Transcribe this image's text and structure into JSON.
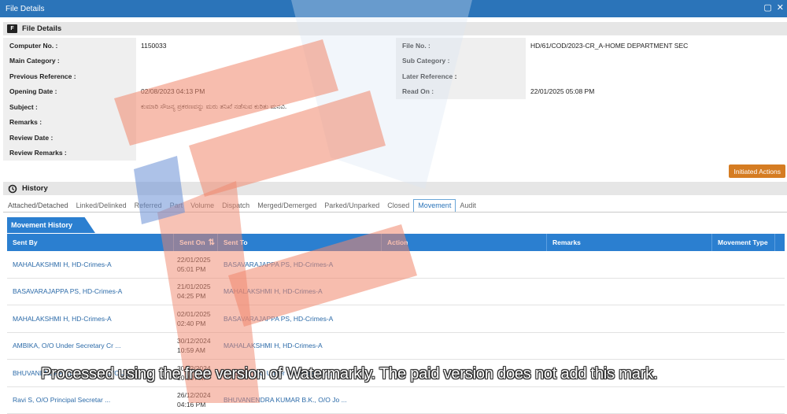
{
  "window": {
    "title": "File Details"
  },
  "file_details": {
    "heading": "File Details",
    "icon_label": "F",
    "left": [
      {
        "label": "Computer No. :",
        "value": "1150033"
      },
      {
        "label": "Main Category :",
        "value": ""
      },
      {
        "label": "Previous Reference :",
        "value": ""
      },
      {
        "label": "Opening Date :",
        "value": "02/08/2023 04:13 PM"
      },
      {
        "label": "Subject :",
        "value": "ಕುಮಾರಿ ಸೌಜನ್ಯ ಪ್ರಕರಣವನ್ನು ಮರು ತನಿಖೆ ನಡೆಸುವ ಕುರಿತು ಮನವಿ."
      },
      {
        "label": "Remarks :",
        "value": ""
      },
      {
        "label": "Review Date :",
        "value": ""
      },
      {
        "label": "Review Remarks :",
        "value": ""
      }
    ],
    "right": [
      {
        "label": "File No. :",
        "value": "HD/61/COD/2023-CR_A-HOME DEPARTMENT SEC"
      },
      {
        "label": "Sub Category :",
        "value": ""
      },
      {
        "label": "Later Reference :",
        "value": ""
      },
      {
        "label": "Read On :",
        "value": "22/01/2025 05:08 PM"
      }
    ]
  },
  "actions_button": "Initiated Actions",
  "history": {
    "heading": "History",
    "tabs": [
      "Attached/Detached",
      "Linked/Delinked",
      "Referred",
      "Part",
      "Volume",
      "Dispatch",
      "Merged/Demerged",
      "Parked/Unparked",
      "Closed",
      "Movement",
      "Audit"
    ],
    "active_tab": "Movement",
    "panel_title": "Movement History",
    "columns": [
      "Sent By",
      "Sent On",
      "Sent To",
      "Action",
      "Remarks",
      "Movement Type"
    ],
    "sort_icon": "sort-icon",
    "rows": [
      {
        "sent_by": "MAHALAKSHMI H, HD-Crimes-A",
        "sent_on_date": "22/01/2025",
        "sent_on_time": "05:01 PM",
        "sent_to": "BASAVARAJAPPA PS, HD-Crimes-A",
        "action": "",
        "remarks": "",
        "movement_type": ""
      },
      {
        "sent_by": "BASAVARAJAPPA PS, HD-Crimes-A",
        "sent_on_date": "21/01/2025",
        "sent_on_time": "04:25 PM",
        "sent_to": "MAHALAKSHMI H, HD-Crimes-A",
        "action": "",
        "remarks": "",
        "movement_type": ""
      },
      {
        "sent_by": "MAHALAKSHMI H, HD-Crimes-A",
        "sent_on_date": "02/01/2025",
        "sent_on_time": "02:40 PM",
        "sent_to": "BASAVARAJAPPA PS, HD-Crimes-A",
        "action": "",
        "remarks": "",
        "movement_type": ""
      },
      {
        "sent_by": "AMBIKA, O/O Under Secretary Cr ...",
        "sent_on_date": "30/12/2024",
        "sent_on_time": "10:59 AM",
        "sent_to": "MAHALAKSHMI H, HD-Crimes-A",
        "action": "",
        "remarks": "",
        "movement_type": ""
      },
      {
        "sent_by": "BHUVANENDRA KUMAR B.K., O/O J ...",
        "sent_on_date": "30/12/2024",
        "sent_on_time": "10:10 AM",
        "sent_to": "AMBIKA, O/O Under Secretary Cr ...",
        "action": "",
        "remarks": "",
        "movement_type": ""
      },
      {
        "sent_by": "Ravi S, O/O Principal Secretar ...",
        "sent_on_date": "26/12/2024",
        "sent_on_time": "04:16 PM",
        "sent_to": "BHUVANENDRA KUMAR B.K., O/O Jo ...",
        "action": "",
        "remarks": "",
        "movement_type": ""
      }
    ]
  },
  "watermark": {
    "text": "Processed using the free version of Watermarkly. The paid version does not add this mark."
  },
  "colors": {
    "titlebar": "#2b74b9",
    "grid_header": "#2b7fd0",
    "action_button": "#d57c22",
    "link": "#2b6aa8"
  }
}
